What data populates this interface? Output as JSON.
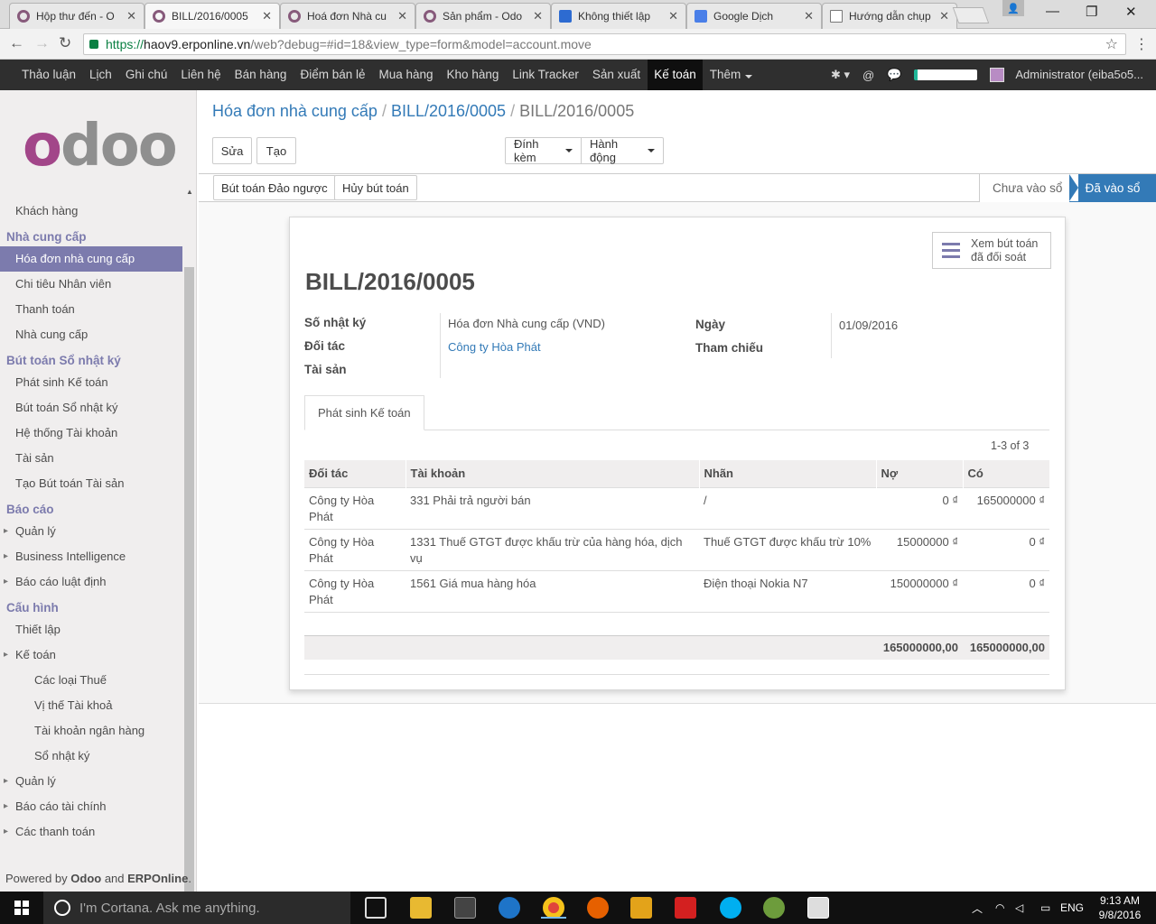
{
  "browser": {
    "tabs": [
      {
        "label": "Hộp thư đến - O",
        "icon": "odoo-icon"
      },
      {
        "label": "BILL/2016/0005",
        "icon": "odoo-icon",
        "active": true
      },
      {
        "label": "Hoá đơn Nhà cu",
        "icon": "odoo-icon"
      },
      {
        "label": "Sản phẩm - Odo",
        "icon": "odoo-icon"
      },
      {
        "label": "Không thiết lập",
        "icon": "translate-icon"
      },
      {
        "label": "Google Dịch",
        "icon": "google-translate-icon"
      },
      {
        "label": "Hướng dẫn chụp",
        "icon": "document-icon"
      }
    ],
    "url_scheme": "https://",
    "url_host": "haov9.erponline.vn",
    "url_path": "/web?debug=#id=18&view_type=form&model=account.move"
  },
  "topnav": {
    "items": [
      "Thảo luận",
      "Lịch",
      "Ghi chú",
      "Liên hệ",
      "Bán hàng",
      "Điểm bán lẻ",
      "Mua hàng",
      "Kho hàng",
      "Link Tracker",
      "Sản xuất",
      "Kế toán",
      "Thêm"
    ],
    "active_index": 10,
    "user": "Administrator (eiba5o5..."
  },
  "sidebar": {
    "logo": "odoo",
    "menu": [
      {
        "kind": "item",
        "label": "Khách hàng"
      },
      {
        "kind": "head",
        "label": "Nhà cung cấp"
      },
      {
        "kind": "item",
        "label": "Hóa đơn nhà cung cấp",
        "active": true
      },
      {
        "kind": "item",
        "label": "Chi tiêu Nhân viên"
      },
      {
        "kind": "item",
        "label": "Thanh toán"
      },
      {
        "kind": "item",
        "label": "Nhà cung cấp"
      },
      {
        "kind": "head",
        "label": "Bút toán Sổ nhật ký"
      },
      {
        "kind": "item",
        "label": "Phát sinh Kế toán"
      },
      {
        "kind": "item",
        "label": "Bút toán Sổ nhật ký"
      },
      {
        "kind": "item",
        "label": "Hệ thống Tài khoản"
      },
      {
        "kind": "item",
        "label": "Tài sản"
      },
      {
        "kind": "item",
        "label": "Tạo Bút toán Tài sản"
      },
      {
        "kind": "head",
        "label": "Báo cáo"
      },
      {
        "kind": "item",
        "label": "Quản lý",
        "caret": true
      },
      {
        "kind": "item",
        "label": "Business Intelligence",
        "caret": true
      },
      {
        "kind": "item",
        "label": "Báo cáo luật định",
        "caret": true
      },
      {
        "kind": "head",
        "label": "Cấu hình"
      },
      {
        "kind": "item",
        "label": "Thiết lập"
      },
      {
        "kind": "item",
        "label": "Kế toán",
        "caret": true
      },
      {
        "kind": "sub",
        "label": "Các loại Thuế"
      },
      {
        "kind": "sub",
        "label": "Vị thế Tài khoả"
      },
      {
        "kind": "sub",
        "label": "Tài khoản ngân hàng"
      },
      {
        "kind": "sub",
        "label": "Sổ nhật ký"
      },
      {
        "kind": "item",
        "label": "Quản lý",
        "caret": true
      },
      {
        "kind": "item",
        "label": "Báo cáo tài chính",
        "caret": true
      },
      {
        "kind": "item",
        "label": "Các thanh toán",
        "caret": true
      }
    ],
    "powered_prefix": "Powered by ",
    "powered_brand1": "Odoo",
    "powered_and": " and ",
    "powered_brand2": "ERPOnline",
    "powered_suffix": "."
  },
  "breadcrumb": {
    "root": "Hóa đơn nhà cung cấp",
    "mid": "BILL/2016/0005",
    "current": "BILL/2016/0005"
  },
  "buttons": {
    "edit": "Sửa",
    "create": "Tạo",
    "attach": "Đính kèm",
    "action": "Hành động",
    "reverse": "Bút toán Đảo ngược",
    "cancel_entry": "Hủy bút toán"
  },
  "status": {
    "draft": "Chưa vào sổ",
    "posted": "Đã vào sổ"
  },
  "form": {
    "smart_button_line1": "Xem bút toán",
    "smart_button_line2": "đã đối soát",
    "title": "BILL/2016/0005",
    "labels": {
      "journal": "Số nhật ký",
      "partner": "Đối tác",
      "asset": "Tài sản",
      "date": "Ngày",
      "reference": "Tham chiếu"
    },
    "values": {
      "journal": "Hóa đơn Nhà cung cấp (VND)",
      "partner": "Công ty Hòa Phát",
      "date": "01/09/2016"
    },
    "tab": "Phát sinh Kế toán",
    "pager": "1-3 of 3",
    "columns": [
      "Đối tác",
      "Tài khoản",
      "Nhãn",
      "Nợ",
      "Có"
    ],
    "rows": [
      [
        "Công ty Hòa Phát",
        "331 Phải trả người bán",
        "/",
        "0 ₫",
        "165000000 ₫"
      ],
      [
        "Công ty Hòa Phát",
        "1331 Thuế GTGT được khấu trừ của hàng hóa, dịch vụ",
        "Thuế GTGT được khấu trừ 10%",
        "15000000 ₫",
        "0 ₫"
      ],
      [
        "Công ty Hòa Phát",
        "1561 Giá mua hàng hóa",
        "Điện thoại Nokia N7",
        "150000000 ₫",
        "0 ₫"
      ]
    ],
    "total_debit": "165000000,00",
    "total_credit": "165000000,00"
  },
  "taskbar": {
    "search_placeholder": "I'm Cortana. Ask me anything.",
    "language": "ENG",
    "time": "9:13 AM",
    "date": "9/8/2016"
  },
  "colors": {
    "accent": "#7c7bad",
    "link": "#337ab7",
    "topnav": "#2f2f2f",
    "odoo_purple": "#a24689"
  }
}
